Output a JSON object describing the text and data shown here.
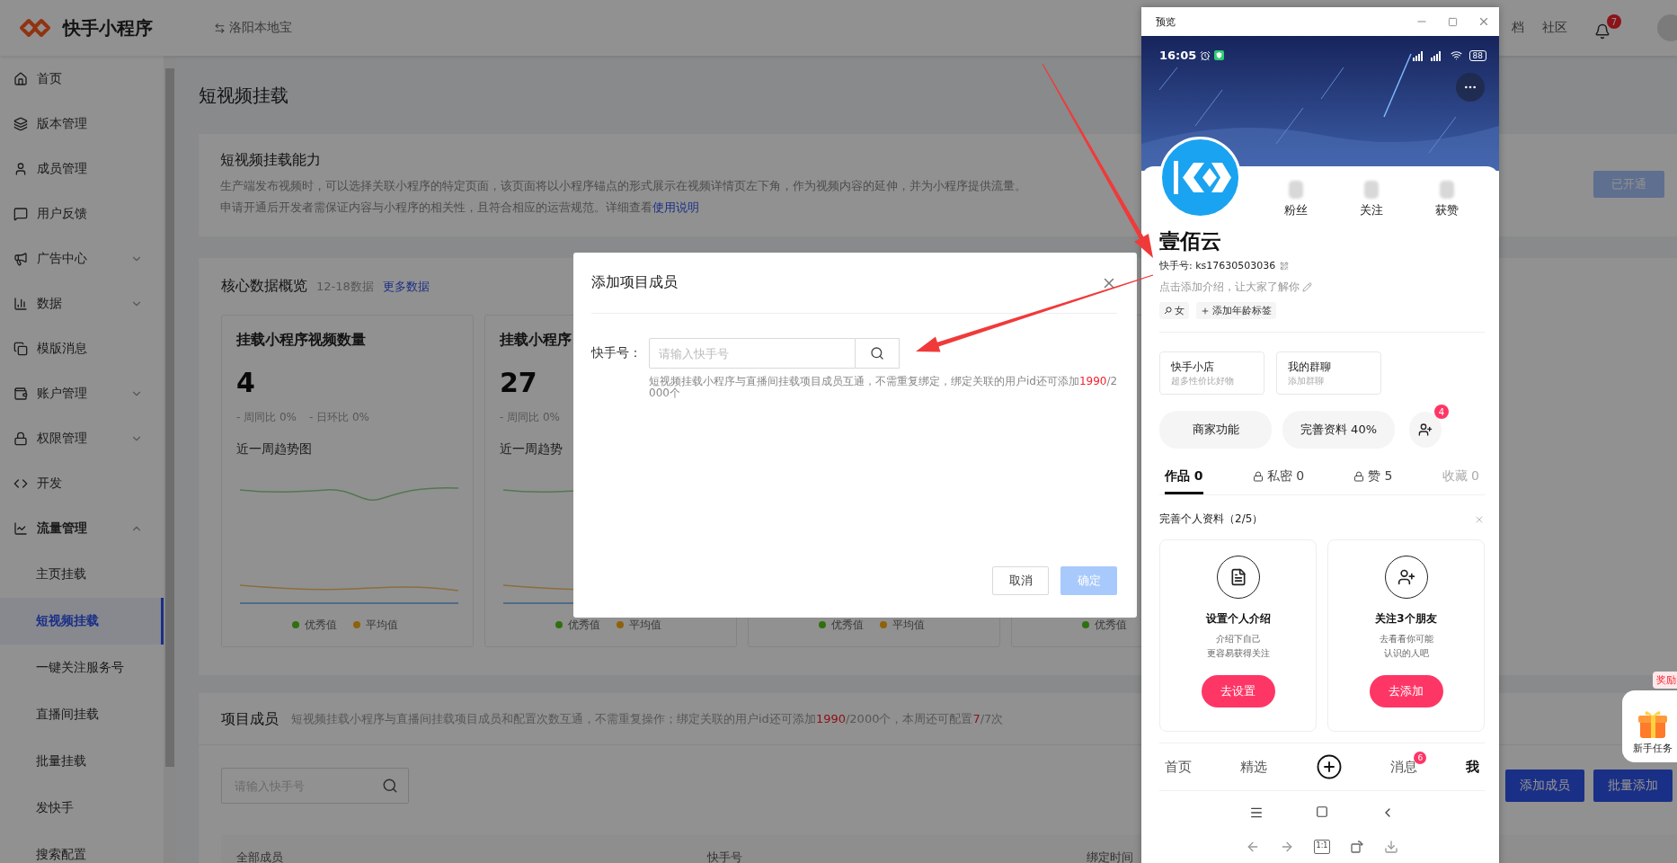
{
  "header": {
    "logo_text": "快手小程序",
    "app_switch": "洛阳本地宝",
    "links": [
      "档",
      "社区"
    ],
    "notification_badge": "7"
  },
  "sidebar": {
    "items": [
      {
        "label": "首页",
        "kind": "page",
        "selected": false
      },
      {
        "label": "版本管理",
        "kind": "page",
        "selected": false
      },
      {
        "label": "成员管理",
        "kind": "page",
        "selected": false
      },
      {
        "label": "用户反馈",
        "kind": "page",
        "selected": false
      },
      {
        "label": "广告中心",
        "kind": "group",
        "expanded": false,
        "selected": false
      },
      {
        "label": "数据",
        "kind": "group",
        "expanded": false,
        "selected": false
      },
      {
        "label": "模版消息",
        "kind": "page",
        "selected": false
      },
      {
        "label": "账户管理",
        "kind": "group",
        "expanded": false,
        "selected": false
      },
      {
        "label": "权限管理",
        "kind": "group",
        "expanded": false,
        "selected": false
      },
      {
        "label": "开发",
        "kind": "page",
        "selected": false
      },
      {
        "label": "流量管理",
        "kind": "group",
        "expanded": true,
        "selected": false,
        "children": [
          {
            "label": "主页挂载",
            "selected": false
          },
          {
            "label": "短视频挂载",
            "selected": true
          },
          {
            "label": "一键关注服务号",
            "selected": false
          },
          {
            "label": "直播间挂载",
            "selected": false
          },
          {
            "label": "批量挂载",
            "selected": false
          },
          {
            "label": "发快手",
            "selected": false
          },
          {
            "label": "搜索配置",
            "selected": false
          }
        ]
      }
    ]
  },
  "page_title": "短视频挂载",
  "capability": {
    "title": "短视频挂载能力",
    "description_lines": [
      "生产端发布视频时，可以选择关联小程序的特定页面，该页面将以小程序锚点的形式展示在视频详情页左下角，作为视频内容的延伸，并为小程序提供流量。",
      "申请开通后开发者需保证内容与小程序的相关性，且符合相应的运营规范。详细查看"
    ],
    "link": "使用说明",
    "button": {
      "label": "已开通",
      "disabled": true
    }
  },
  "overview": {
    "title": "核心数据概览",
    "date": "12-18数据",
    "more_link": "更多数据",
    "cards": [
      {
        "title": "挂载小程序视频数量",
        "value": "4",
        "compare": [
          "- 周同比 0%",
          "- 日环比 0%"
        ],
        "trend_title": "近一周趋势图",
        "legend": [
          {
            "label": "优秀值",
            "color": "#2f700f"
          },
          {
            "label": "平均值",
            "color": "#8e620b"
          }
        ]
      },
      {
        "title": "挂载小程序",
        "value": "27",
        "compare": [
          "- 周同比 0%"
        ],
        "trend_title": "近一周趋势",
        "legend": [
          {
            "label": "优秀值",
            "color": "#2f700f"
          },
          {
            "label": "平均值",
            "color": "#8e620b"
          }
        ]
      },
      {
        "legend": [
          {
            "label": "优秀值",
            "color": "#2f700f"
          },
          {
            "label": "平均值",
            "color": "#8e620b"
          }
        ]
      },
      {
        "legend": [
          {
            "label": "优秀值",
            "color": "#2f700f"
          }
        ]
      }
    ]
  },
  "members": {
    "title": "项目成员",
    "description": [
      {
        "text": "短视频挂载小程序与直播间挂载项目成员和配置次数互通，不需重复操作；绑定关联的用户id还可添加",
        "highlight": false
      },
      {
        "text": "1990",
        "highlight": true
      },
      {
        "text": "/2000个，本周还可配置",
        "highlight": false
      },
      {
        "text": "7",
        "highlight": true
      },
      {
        "text": "/7次",
        "highlight": false
      }
    ],
    "search_placeholder": "请输入快手号",
    "buttons": [
      "添加成员",
      "批量添加"
    ],
    "columns": [
      "全部成员",
      "快手号",
      "绑定时间"
    ]
  },
  "dialog": {
    "title": "添加项目成员",
    "field_label": "快手号：",
    "placeholder": "请输入快手号",
    "hint": [
      {
        "text": "短视频挂载小程序与直播间挂载项目成员互通，不需重复绑定，绑定关联的用户id还可添加",
        "highlight": false
      },
      {
        "text": "1990",
        "highlight": true
      },
      {
        "text": "/2000个",
        "highlight": false
      }
    ],
    "buttons": [
      {
        "label": "取消",
        "kind": "secondary",
        "disabled": false
      },
      {
        "label": "确定",
        "kind": "primary",
        "disabled": true
      }
    ]
  },
  "preview": {
    "title": "预览",
    "status_time": "16:05",
    "battery": "88",
    "stats": [
      "粉丝",
      "关注",
      "获赞"
    ],
    "name": "壹佰云",
    "account": "快手号: ks17630503036",
    "intro_placeholder": "点击添加介绍，让大家了解你",
    "tags": [
      {
        "kind": "gender",
        "label": "女"
      },
      {
        "kind": "add",
        "label": "添加年龄标签"
      }
    ],
    "shortcuts": [
      {
        "title": "快手小店",
        "subtitle": "超多性价比好物"
      },
      {
        "title": "我的群聊",
        "subtitle": "添加群聊"
      }
    ],
    "actions": [
      "商家功能",
      "完善资料 40%"
    ],
    "friend_badge": "4",
    "tabs": [
      {
        "label": "作品 0",
        "selected": true,
        "locked": false,
        "disabled": false
      },
      {
        "label": "私密 0",
        "selected": false,
        "locked": true,
        "disabled": false
      },
      {
        "label": "赞 5",
        "selected": false,
        "locked": true,
        "disabled": false
      },
      {
        "label": "收藏 0",
        "selected": false,
        "locked": false,
        "disabled": true
      }
    ],
    "tasks_title": "完善个人资料（2/5）",
    "tasks": [
      {
        "kind": "intro",
        "title": "设置个人介绍",
        "lines": [
          "介绍下自己",
          "更容易获得关注"
        ],
        "button": "去设置"
      },
      {
        "kind": "friends",
        "title": "关注3个朋友",
        "lines": [
          "去看看你可能",
          "认识的人吧"
        ],
        "button": "去添加"
      }
    ],
    "bottom_nav": [
      {
        "kind": "tab",
        "label": "首页",
        "selected": false
      },
      {
        "kind": "tab",
        "label": "精选",
        "selected": false
      },
      {
        "kind": "create"
      },
      {
        "kind": "tab",
        "label": "消息",
        "badge": "6",
        "selected": false
      },
      {
        "kind": "tab",
        "label": "我",
        "selected": true
      }
    ],
    "zoom_label": "1:1"
  },
  "gift_widget": {
    "tag": "奖励",
    "label": "新手任务"
  }
}
